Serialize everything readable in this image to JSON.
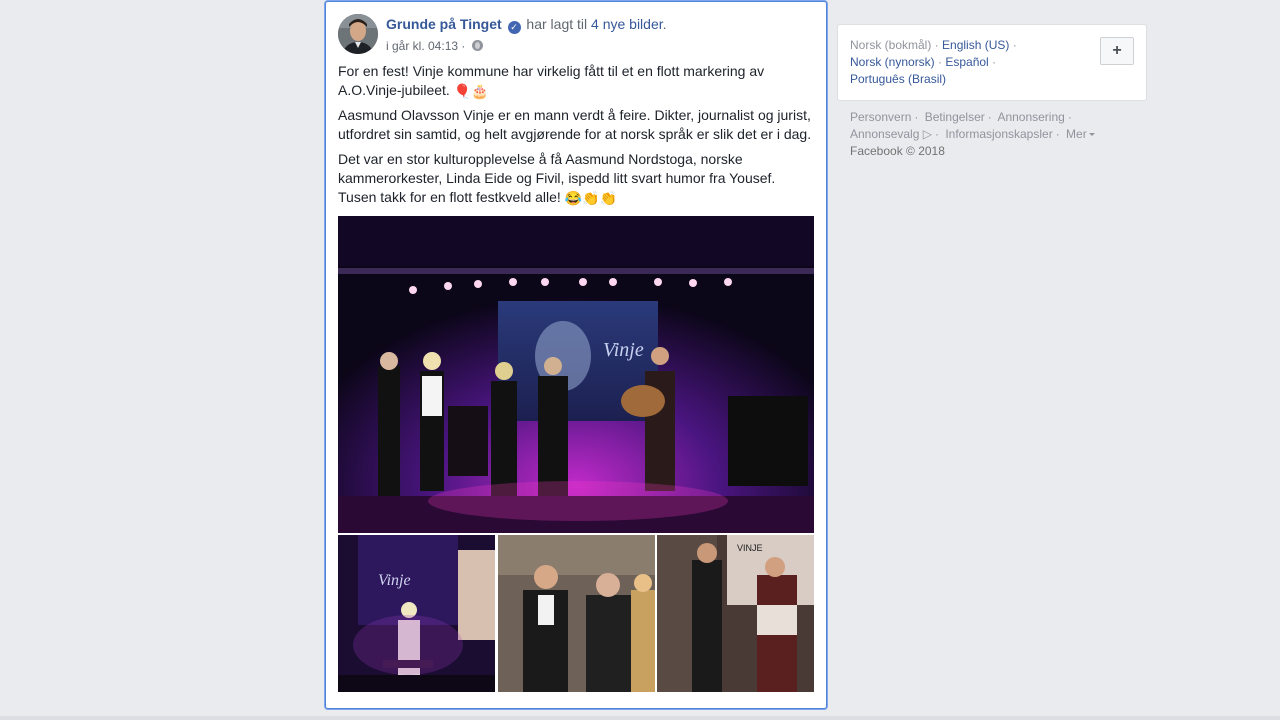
{
  "post": {
    "author": "Grunde på Tinget",
    "action_prefix": "har lagt til",
    "action_link": "4 nye bilder",
    "action_suffix": ".",
    "timestamp": "i går kl. 04:13 ·",
    "paragraph1": "For en fest! Vinje kommune har virkelig fått til et en flott markering av A.O.Vinje-jubileet.",
    "paragraph1_emoji": "🎈🎂",
    "paragraph2": "Aasmund Olavsson Vinje er en mann verdt å feire. Dikter, journalist og jurist, utfordret sin samtid, og helt avgjørende for at norsk språk er slik det er i dag.",
    "paragraph3": "Det var en stor kulturopplevelse å få Aasmund Nordstoga, norske kammerorkester, Linda Eide og Fivil, ispedd litt svart humor fra Yousef. Tusen takk for en flott festkveld alle!",
    "paragraph3_emoji": "😂👏👏"
  },
  "sidebar": {
    "languages": {
      "current": "Norsk (bokmål)",
      "options": [
        "English (US)",
        "Norsk (nynorsk)",
        "Español",
        "Português (Brasil)"
      ]
    },
    "plus_label": "+",
    "footer_links": [
      "Personvern",
      "Betingelser",
      "Annonsering",
      "Annonsevalg",
      "Informasjonskapsler",
      "Mer"
    ],
    "copyright": "Facebook © 2018"
  },
  "icons": {
    "verified": "verified-badge-icon",
    "audience": "globe-icon",
    "adchoices": "adchoices-icon"
  },
  "colors": {
    "link": "#365899",
    "background": "#e9ebee",
    "focus_border": "#4c84dc"
  }
}
